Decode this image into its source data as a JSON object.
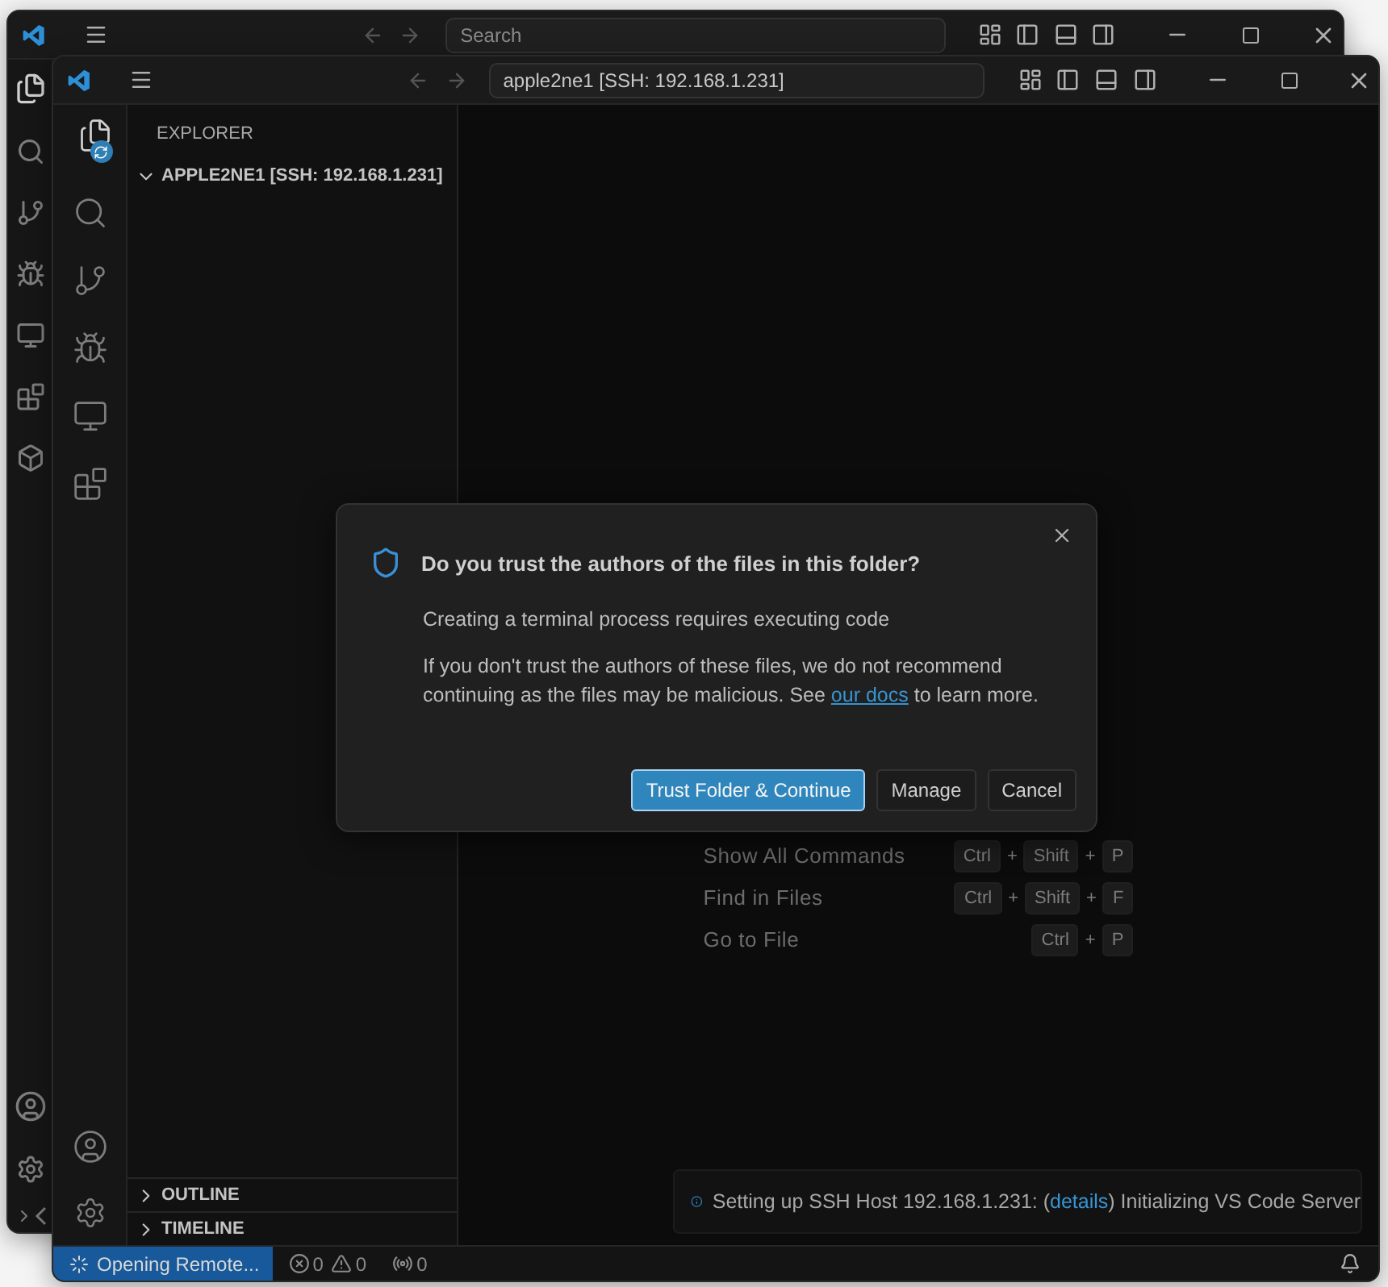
{
  "back_window": {
    "search": {
      "placeholder": "Search"
    }
  },
  "window": {
    "title": "apple2ne1 [SSH: 192.168.1.231]"
  },
  "activity_bar": [
    {
      "kind": "explorer",
      "selected": true
    },
    {
      "kind": "search",
      "selected": false
    },
    {
      "kind": "source-control",
      "selected": false
    },
    {
      "kind": "run-debug",
      "selected": false
    },
    {
      "kind": "remote",
      "selected": false
    },
    {
      "kind": "extensions",
      "selected": false
    }
  ],
  "sidebar": {
    "title": "EXPLORER",
    "folder": {
      "label": "APPLE2NE1 [SSH: 192.168.1.231]",
      "expanded": true
    },
    "sections": [
      {
        "label": "OUTLINE",
        "expanded": false
      },
      {
        "label": "TIMELINE",
        "expanded": false
      }
    ]
  },
  "shortcuts": [
    {
      "label": "Show All Commands",
      "keys": [
        {
          "kind": "key",
          "label": "Ctrl"
        },
        {
          "kind": "plus",
          "label": "+"
        },
        {
          "kind": "key",
          "label": "Shift"
        },
        {
          "kind": "plus",
          "label": "+"
        },
        {
          "kind": "key",
          "label": "P"
        }
      ]
    },
    {
      "label": "Find in Files",
      "keys": [
        {
          "kind": "key",
          "label": "Ctrl"
        },
        {
          "kind": "plus",
          "label": "+"
        },
        {
          "kind": "key",
          "label": "Shift"
        },
        {
          "kind": "plus",
          "label": "+"
        },
        {
          "kind": "key",
          "label": "F"
        }
      ]
    },
    {
      "label": "Go to File",
      "keys": [
        {
          "kind": "key",
          "label": "Ctrl"
        },
        {
          "kind": "plus",
          "label": "+"
        },
        {
          "kind": "key",
          "label": "P"
        }
      ]
    }
  ],
  "dialog": {
    "title": "Do you trust the authors of the files in this folder?",
    "message": "Creating a terminal process requires executing code",
    "detail": "If you don't trust the authors of these files, we do not recommend continuing as the files may be malicious. See ",
    "link": "our docs",
    "detail_end": " to learn more.",
    "buttons": [
      {
        "label": "Trust Folder & Continue",
        "primary": true
      },
      {
        "label": "Manage",
        "primary": false
      },
      {
        "label": "Cancel",
        "primary": false
      }
    ]
  },
  "notification": {
    "text": "Setting up SSH Host 192.168.1.231: (",
    "link": "details",
    "text_end": ") Initializing VS Code Server"
  },
  "status_bar": {
    "remote": "Opening Remote...",
    "errors": "0",
    "warnings": "0",
    "ports": "0"
  }
}
